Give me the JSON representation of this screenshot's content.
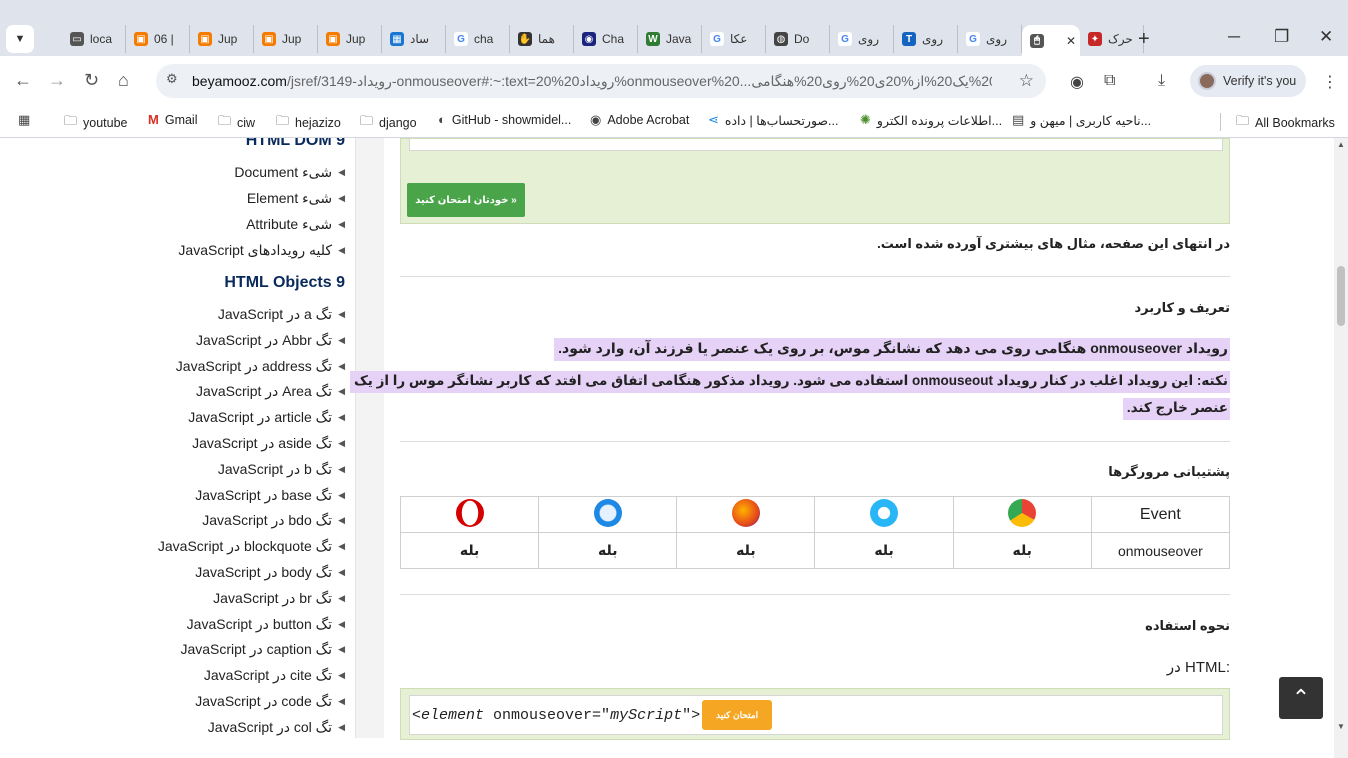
{
  "browser": {
    "tabs": [
      {
        "label": "loca",
        "icon": "window-icon",
        "color": "#555555"
      },
      {
        "label": "06 |",
        "icon": "orange-square-icon",
        "color": "#f57c00"
      },
      {
        "label": "Jup",
        "icon": "orange-square-icon",
        "color": "#f57c00"
      },
      {
        "label": "Jup",
        "icon": "orange-square-icon",
        "color": "#f57c00"
      },
      {
        "label": "Jup",
        "icon": "orange-square-icon",
        "color": "#f57c00"
      },
      {
        "label": "ساد",
        "icon": "blue-grid-icon",
        "color": "#1976d2"
      },
      {
        "label": "cha",
        "icon": "google-icon",
        "color": "#4285f4"
      },
      {
        "label": "هما",
        "icon": "hand-icon",
        "color": "#333333"
      },
      {
        "label": "Cha",
        "icon": "eye-icon",
        "color": "#1a237e"
      },
      {
        "label": "Java",
        "icon": "w-icon",
        "color": "#2e7d32"
      },
      {
        "label": "عکا",
        "icon": "google-icon",
        "color": "#4285f4"
      },
      {
        "label": "Do",
        "icon": "globe-icon",
        "color": "#444444"
      },
      {
        "label": "روی",
        "icon": "google-icon",
        "color": "#4285f4"
      },
      {
        "label": "روی",
        "icon": "t-icon",
        "color": "#1565c0"
      },
      {
        "label": "روی",
        "icon": "google-icon",
        "color": "#4285f4"
      },
      {
        "label": "",
        "icon": "mouse-icon",
        "color": "#555555",
        "active": true
      },
      {
        "label": "حرک",
        "icon": "figure-icon",
        "color": "#c62828"
      }
    ],
    "url_domain": "beyamooz.com",
    "url_path": "/jsref/3149-رویداد-onmouseover#:~:text=20%رویداد20%onmouseover%20...خا20%عنصر20%یک20%از%20ی20%روی20%هنگامی",
    "verify_label": "Verify it's you",
    "bookmarks": [
      {
        "label": "youtube",
        "icon": "folder-icon"
      },
      {
        "label": "Gmail",
        "icon": "gmail-icon"
      },
      {
        "label": "ciw",
        "icon": "folder-icon"
      },
      {
        "label": "hejazizo",
        "icon": "folder-icon"
      },
      {
        "label": "django",
        "icon": "folder-icon"
      },
      {
        "label": "GitHub - showmidel...",
        "icon": "github-icon"
      },
      {
        "label": "Adobe Acrobat",
        "icon": "acrobat-icon"
      },
      {
        "label": "صورتحساب‌ها | داده...",
        "icon": "share-icon"
      },
      {
        "label": "اطلاعات پرونده الکترو...",
        "icon": "gear-green-icon"
      },
      {
        "label": "ناحیه کاربری | میهن و...",
        "icon": "doc-icon"
      },
      {
        "label": "All Bookmarks",
        "icon": "folder-icon"
      }
    ]
  },
  "sidebar": {
    "section1_title": "HTML DOM 9",
    "section1_items": [
      "شیء Document",
      "شیء Element",
      "شیء Attribute",
      "کلیه رویدادهای JavaScript"
    ],
    "section2_title": "HTML Objects 9",
    "section2_items": [
      "تگ a در JavaScript",
      "تگ Abbr در JavaScript",
      "تگ address در JavaScript",
      "تگ Area در JavaScript",
      "تگ article در JavaScript",
      "تگ aside در JavaScript",
      "تگ b در JavaScript",
      "تگ base در JavaScript",
      "تگ bdo در JavaScript",
      "تگ blockquote در JavaScript",
      "تگ body در JavaScript",
      "تگ br در JavaScript",
      "تگ button در JavaScript",
      "تگ caption در JavaScript",
      "تگ cite در JavaScript",
      "تگ code در JavaScript",
      "تگ col در JavaScript"
    ]
  },
  "main": {
    "try_button": "خودتان امتحان کنید »",
    "end_note": "در انتهای این صفحه، مثال های بیشتری آورده شده است.",
    "definition_heading": "تعریف و کاربرد",
    "definition_text": "رویداد onmouseover هنگامی روی می دهد که نشانگر موس، بر روی یک عنصر یا فرزند آن، وارد شود.",
    "note_line1": "نکته: این رویداد اغلب در کنار رویداد onmouseout استفاده می شود. رویداد مذکور هنگامی اتفاق می افتد که کاربر نشانگر موس را از یک",
    "note_line2": "عنصر خارج کند.",
    "support_heading": "پشتیبانی مرورگرها",
    "table_header": "Event",
    "table_event": "onmouseover",
    "browsers": [
      "chrome-icon",
      "ie-icon",
      "firefox-icon",
      "safari-icon",
      "opera-icon"
    ],
    "support_values": [
      "بله",
      "بله",
      "بله",
      "بله",
      "بله"
    ],
    "usage_heading": "نحوه استفاده",
    "in_html_label": "در HTML:",
    "code_prefix": "<",
    "code_tag": "element",
    "code_attr": " onmouseover=\"",
    "code_val": "myScript",
    "code_suffix": "\">",
    "code_button": "امتحان کنید"
  }
}
